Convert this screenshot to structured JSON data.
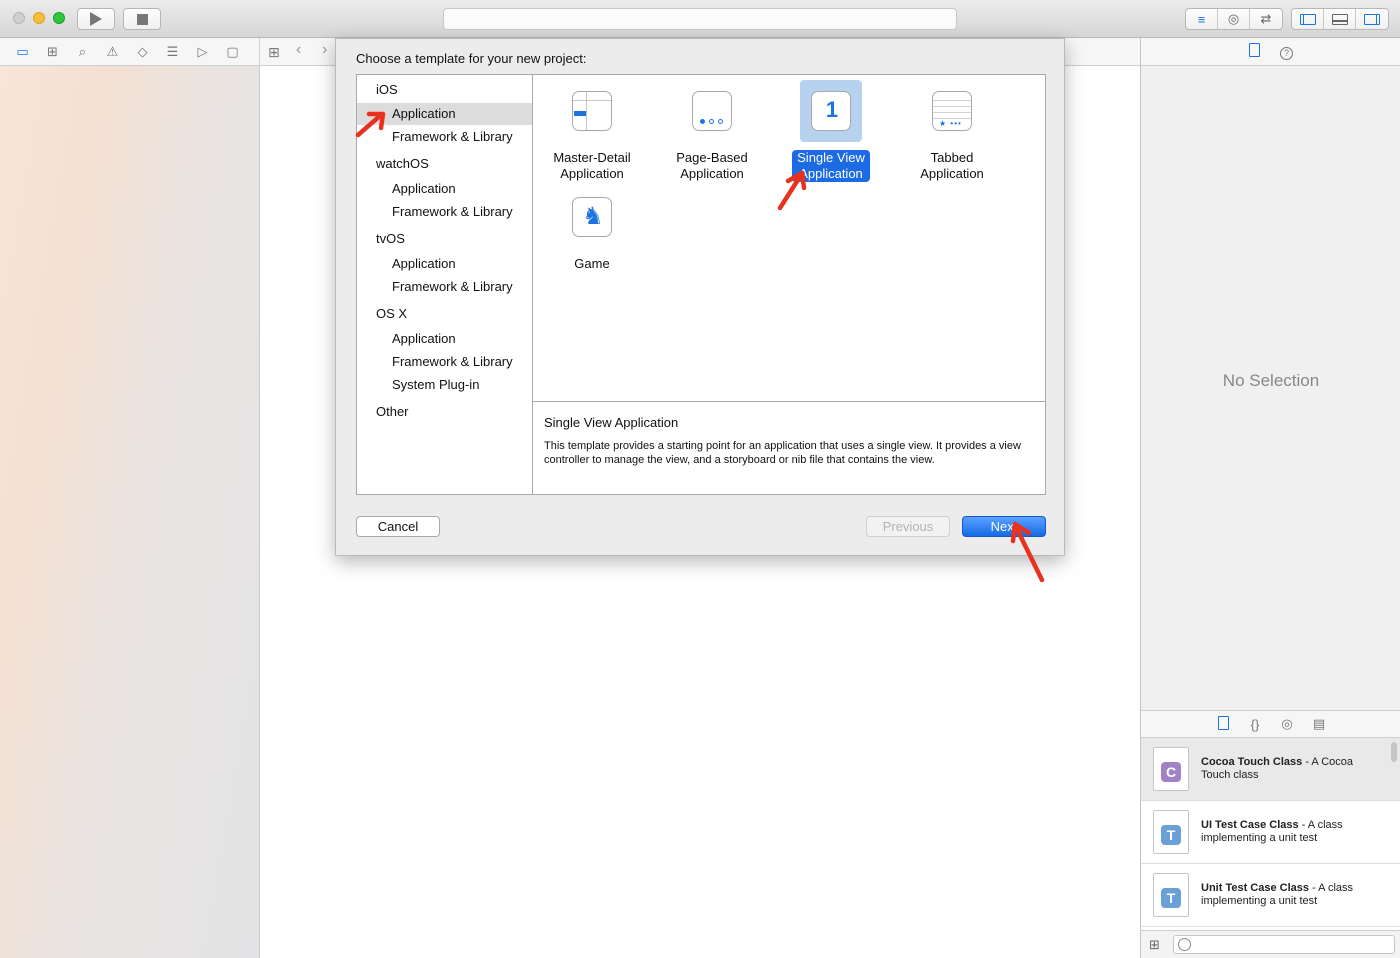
{
  "toolbar": {
    "run_icon": "play-icon",
    "stop_icon": "stop-icon",
    "editor_modes": [
      "standard-editor-icon",
      "assistant-editor-icon",
      "version-editor-icon"
    ],
    "view_toggles": [
      "navigator-toggle-icon",
      "debug-area-toggle-icon",
      "utilities-toggle-icon"
    ]
  },
  "navigator_tabs": [
    "folder-icon",
    "hierarchy-icon",
    "search-icon",
    "warning-icon",
    "test-icon",
    "debug-icon",
    "breakpoint-icon",
    "report-icon"
  ],
  "sheet": {
    "title": "Choose a template for your new project:",
    "categories": [
      {
        "name": "iOS",
        "items": [
          "Application",
          "Framework & Library"
        ]
      },
      {
        "name": "watchOS",
        "items": [
          "Application",
          "Framework & Library"
        ]
      },
      {
        "name": "tvOS",
        "items": [
          "Application",
          "Framework & Library"
        ]
      },
      {
        "name": "OS X",
        "items": [
          "Application",
          "Framework & Library",
          "System Plug-in"
        ]
      },
      {
        "name": "Other",
        "items": []
      }
    ],
    "selected_category": "iOS / Application",
    "templates": [
      {
        "line1": "Master-Detail",
        "line2": "Application",
        "icon": "master-detail-icon"
      },
      {
        "line1": "Page-Based",
        "line2": "Application",
        "icon": "page-based-icon"
      },
      {
        "line1": "Single View",
        "line2": "Application",
        "icon": "single-view-icon",
        "selected": true
      },
      {
        "line1": "Tabbed",
        "line2": "Application",
        "icon": "tabbed-icon"
      },
      {
        "line1": "Game",
        "line2": "",
        "icon": "game-icon"
      }
    ],
    "description_title": "Single View Application",
    "description_body": "This template provides a starting point for an application that uses a single view. It provides a view controller to manage the view, and a storyboard or nib file that contains the view.",
    "buttons": {
      "cancel": "Cancel",
      "previous": "Previous",
      "next": "Next"
    }
  },
  "inspector": {
    "no_selection": "No Selection",
    "library": [
      {
        "title": "Cocoa Touch Class",
        "desc": " - A Cocoa Touch class",
        "glyph": "C"
      },
      {
        "title": "UI Test Case Class",
        "desc": " - A class implementing a unit test",
        "glyph": "T"
      },
      {
        "title": "Unit Test Case Class",
        "desc": " - A class implementing a unit test",
        "glyph": "T"
      }
    ]
  },
  "colors": {
    "accent": "#1d74e0",
    "selection": "#1d6ae5",
    "annotation_arrow": "#e8321e"
  }
}
